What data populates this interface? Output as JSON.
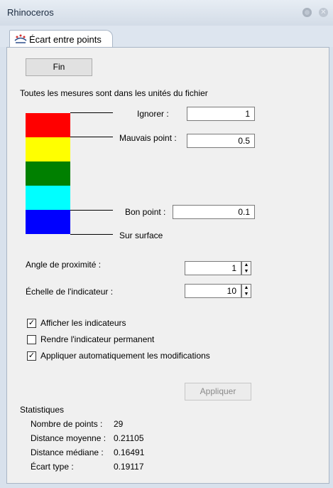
{
  "window": {
    "title": "Rhinoceros"
  },
  "tab": {
    "label": "Écart entre points"
  },
  "buttons": {
    "fin": "Fin",
    "apply": "Appliquer"
  },
  "info": "Toutes les mesures sont dans les unités du fichier",
  "legend": {
    "colors": [
      "#ff0000",
      "#ffff00",
      "#008000",
      "#00ffff",
      "#0000ff"
    ],
    "ignore_label": "Ignorer :",
    "ignore_value": "1",
    "bad_label": "Mauvais point :",
    "bad_value": "0.5",
    "good_label": "Bon point :",
    "good_value": "0.1",
    "surface_label": "Sur surface"
  },
  "settings": {
    "angle_label": "Angle de proximité :",
    "angle_value": "1",
    "scale_label": "Échelle de l'indicateur :",
    "scale_value": "10"
  },
  "options": [
    {
      "label": "Afficher les indicateurs",
      "checked": true
    },
    {
      "label": "Rendre l'indicateur permanent",
      "checked": false
    },
    {
      "label": "Appliquer automatiquement les modifications",
      "checked": true
    }
  ],
  "stats": {
    "title": "Statistiques",
    "rows": [
      {
        "label": "Nombre de points :",
        "value": "29"
      },
      {
        "label": "Distance moyenne :",
        "value": "0.21105"
      },
      {
        "label": "Distance médiane :",
        "value": "0.16491"
      },
      {
        "label": "Écart type :",
        "value": "0.19117"
      }
    ]
  }
}
